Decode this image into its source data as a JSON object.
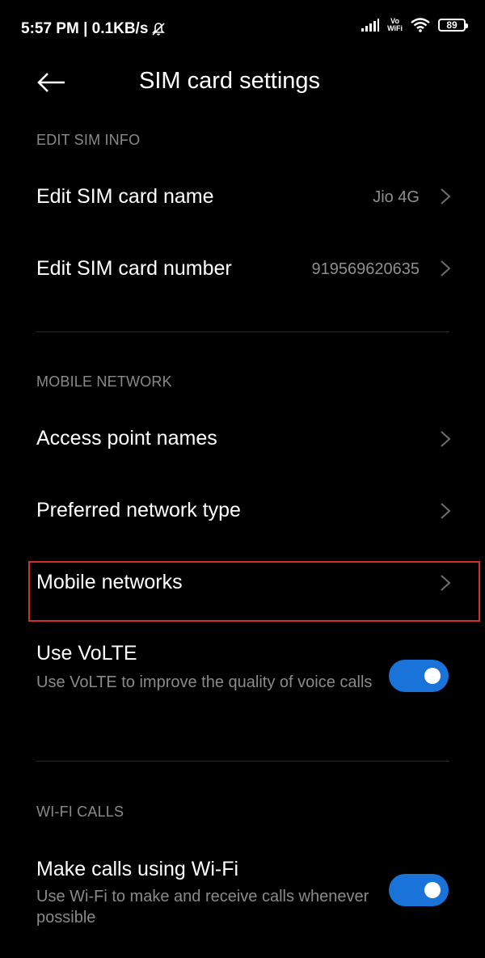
{
  "status": {
    "time": "5:57 PM | 0.1KB/s",
    "volte_top": "Vo",
    "volte_bottom": "WiFi",
    "battery": "89"
  },
  "header": {
    "title": "SIM card settings"
  },
  "sections": {
    "edit_sim_info": "EDIT SIM INFO",
    "mobile_network": "MOBILE NETWORK",
    "wifi_calls": "WI-FI CALLS"
  },
  "rows": {
    "edit_name": {
      "label": "Edit SIM card name",
      "value": "Jio 4G"
    },
    "edit_number": {
      "label": "Edit SIM card number",
      "value": "919569620635"
    },
    "apn": {
      "label": "Access point names"
    },
    "preferred": {
      "label": "Preferred network type"
    },
    "mobile_networks": {
      "label": "Mobile networks"
    },
    "volte": {
      "label": "Use VoLTE",
      "description": "Use VoLTE to improve the quality of voice calls",
      "enabled": true
    },
    "wifi_calling": {
      "label": "Make calls using Wi-Fi",
      "description": "Use Wi-Fi to make and receive calls whenever possible",
      "enabled": true
    }
  },
  "colors": {
    "accent": "#1a73d9",
    "highlight": "#d32f2f"
  }
}
